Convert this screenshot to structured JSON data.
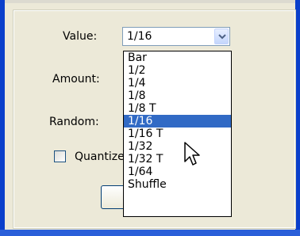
{
  "form": {
    "value_label": "Value:",
    "amount_label": "Amount:",
    "random_label": "Random:",
    "quantize_label": "Quantize",
    "value_selected": "1/16",
    "quantize_checked": false
  },
  "dropdown": {
    "options": [
      "Bar",
      "1/2",
      "1/4",
      "1/8",
      "1/8 T",
      "1/16",
      "1/16 T",
      "1/32",
      "1/32 T",
      "1/64",
      "Shuffle"
    ],
    "selected_index": 5
  },
  "icons": {
    "combo_arrow": "chevron-down-icon",
    "cursor": "mouse-pointer-icon"
  },
  "colors": {
    "panel_bg": "#ece9d8",
    "selection_bg": "#316ac5",
    "frame_blue": "#0a3fcb"
  }
}
